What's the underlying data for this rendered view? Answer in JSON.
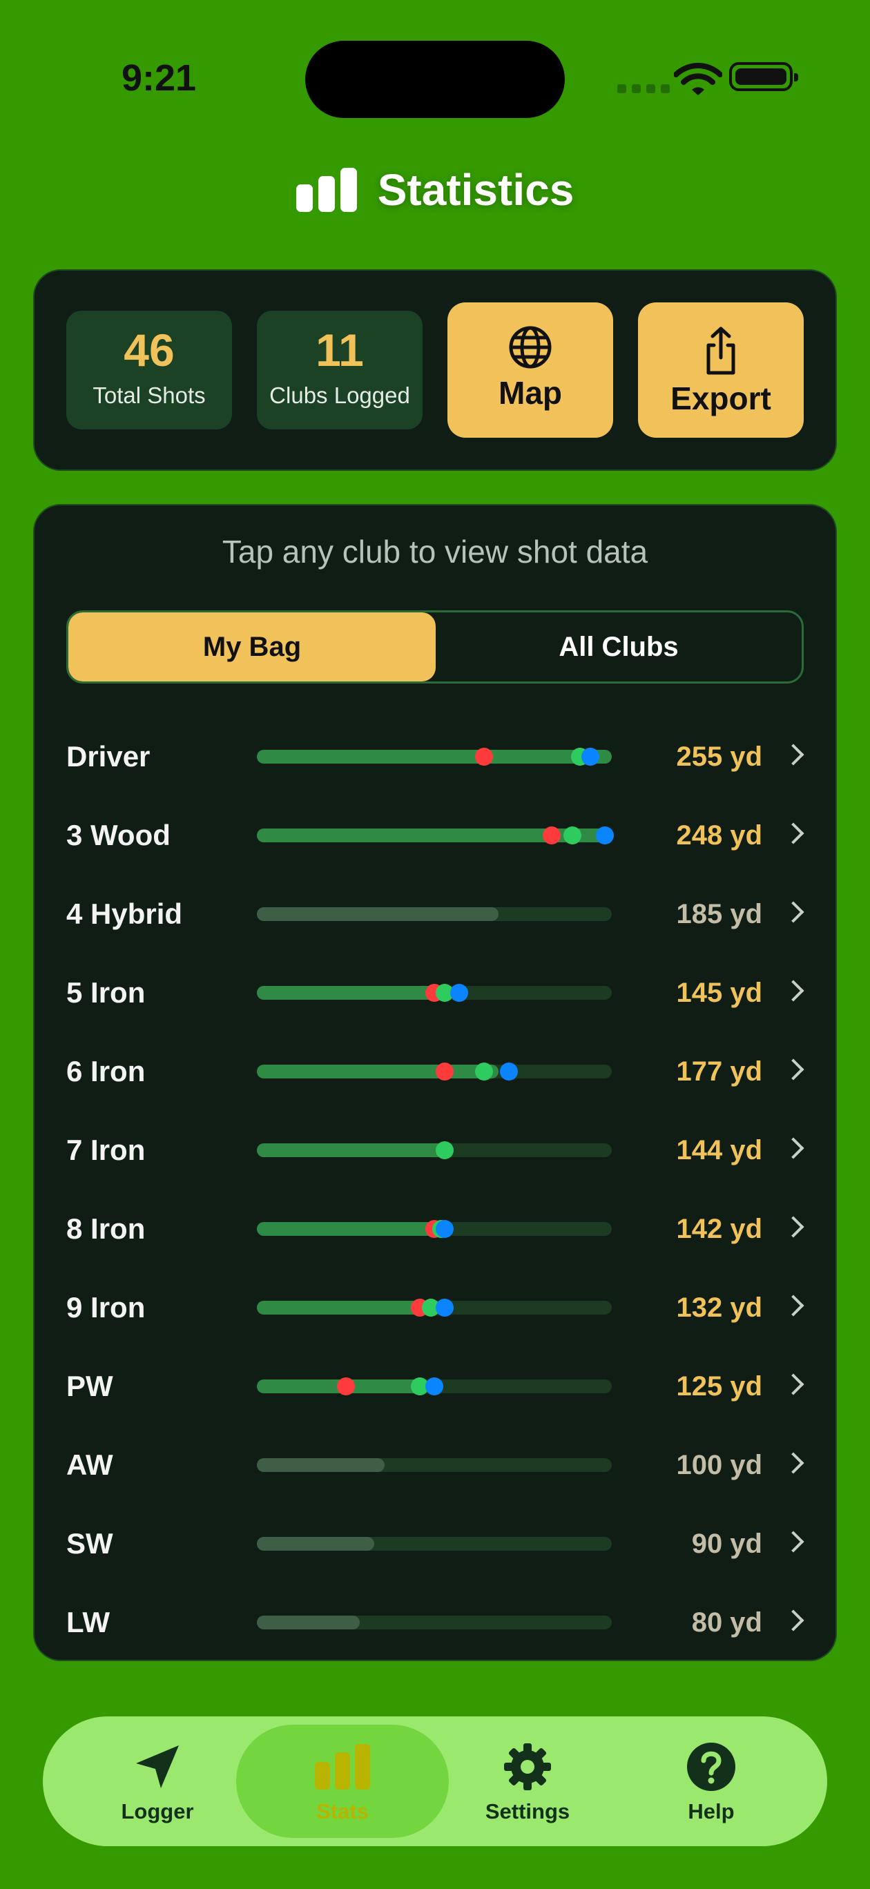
{
  "status_bar": {
    "time": "9:21"
  },
  "header": {
    "title": "Statistics"
  },
  "summary": {
    "total_shots": "46",
    "total_shots_label": "Total Shots",
    "clubs_logged": "11",
    "clubs_logged_label": "Clubs Logged",
    "map_label": "Map",
    "export_label": "Export"
  },
  "list": {
    "hint": "Tap any club to view shot data",
    "tabs": {
      "active": "My Bag",
      "inactive": "All Clubs"
    },
    "clubs": [
      {
        "name": "Driver",
        "distance": "255 yd",
        "has_data": true,
        "bar_fraction": 1.0,
        "markers": [
          0.64,
          0.91,
          0.94
        ]
      },
      {
        "name": "3 Wood",
        "distance": "248 yd",
        "has_data": true,
        "bar_fraction": 1.0,
        "markers": [
          0.83,
          0.89,
          0.98
        ]
      },
      {
        "name": "4 Hybrid",
        "distance": "185 yd",
        "has_data": false,
        "bar_fraction": 0.68,
        "markers": []
      },
      {
        "name": "5 Iron",
        "distance": "145 yd",
        "has_data": true,
        "bar_fraction": 0.55,
        "markers": [
          0.5,
          0.53,
          0.57
        ]
      },
      {
        "name": "6 Iron",
        "distance": "177 yd",
        "has_data": true,
        "bar_fraction": 0.68,
        "markers": [
          0.53,
          0.64,
          0.71
        ]
      },
      {
        "name": "7 Iron",
        "distance": "144 yd",
        "has_data": true,
        "bar_fraction": 0.53,
        "markers": [
          null,
          0.53,
          null
        ]
      },
      {
        "name": "8 Iron",
        "distance": "142 yd",
        "has_data": true,
        "bar_fraction": 0.53,
        "markers": [
          0.5,
          0.52,
          0.53
        ]
      },
      {
        "name": "9 Iron",
        "distance": "132 yd",
        "has_data": true,
        "bar_fraction": 0.48,
        "markers": [
          0.46,
          0.49,
          0.53
        ]
      },
      {
        "name": "PW",
        "distance": "125 yd",
        "has_data": true,
        "bar_fraction": 0.48,
        "markers": [
          0.25,
          0.46,
          0.5
        ]
      },
      {
        "name": "AW",
        "distance": "100 yd",
        "has_data": false,
        "bar_fraction": 0.36,
        "markers": []
      },
      {
        "name": "SW",
        "distance": "90 yd",
        "has_data": false,
        "bar_fraction": 0.33,
        "markers": []
      },
      {
        "name": "LW",
        "distance": "80 yd",
        "has_data": false,
        "bar_fraction": 0.29,
        "markers": []
      }
    ]
  },
  "marker_colors": [
    "#ff3b3b",
    "#2ecc5e",
    "#0a84ff"
  ],
  "colors": {
    "background": "#349a00",
    "accent": "#f2c25a",
    "logged_bar": "#2e8a45",
    "unlogged_bar": "#3f5e46",
    "logged_distance": "#f2c25a",
    "unlogged_distance": "#c3bca6"
  },
  "tabbar": {
    "items": [
      {
        "label": "Logger",
        "icon": "location-arrow-icon",
        "selected": false
      },
      {
        "label": "Stats",
        "icon": "bar-chart-icon",
        "selected": true
      },
      {
        "label": "Settings",
        "icon": "gear-icon",
        "selected": false
      },
      {
        "label": "Help",
        "icon": "question-circle-icon",
        "selected": false
      }
    ]
  }
}
